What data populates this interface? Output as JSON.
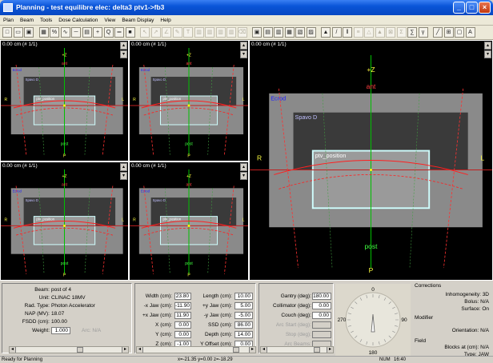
{
  "window": {
    "title": "Planning - test equilibre elec: delta3 ptv1->fb3"
  },
  "menu": [
    "Plan",
    "Beam",
    "Tools",
    "Dose Calculation",
    "View",
    "Beam Display",
    "Help"
  ],
  "toolbar_icons": [
    "new-icon",
    "open-icon",
    "save-icon",
    "grid-icon",
    "percent-icon",
    "isodose-icon",
    "ruler-icon",
    "table-icon",
    "crosshair-icon",
    "zoom-icon",
    "measure-icon",
    "color-icon",
    "pointer-icon",
    "arrow-icon",
    "contour-icon",
    "edit-icon",
    "text-icon",
    "layout-icon",
    "layout-icon",
    "layout-icon",
    "layout-icon",
    "eraser-icon",
    "view1-icon",
    "view2-icon",
    "view3-icon",
    "view4-icon",
    "view5-icon",
    "view6-icon",
    "warning-icon",
    "pencil-icon",
    "chart-icon",
    "align-icon",
    "triangle-icon",
    "warning-icon",
    "matrix-icon",
    "sum-icon",
    "sigma-icon",
    "gamma-icon",
    "dvh-icon",
    "view-icon",
    "window-icon",
    "font-icon"
  ],
  "views": [
    {
      "label": "0.00 cm (# 1/1)",
      "anterior": "ant",
      "posterior": "post",
      "top": "+Z",
      "bottom": "P",
      "left": "R",
      "right": "L",
      "structure_body": "Ecrod",
      "structure_spine": "Spavo D",
      "structure_ptv": "ptv_position"
    },
    {
      "label": "0.00 cm (# 1/1)",
      "anterior": "ant",
      "posterior": "post",
      "top": "+Z",
      "bottom": "P",
      "left": "R",
      "right": "L",
      "structure_body": "Ecrod",
      "structure_spine": "Spavo D",
      "structure_ptv": "ptv_position"
    },
    {
      "label": "0.00 cm (# 1/1)",
      "anterior": "ant",
      "posterior": "post",
      "top": "+Z",
      "bottom": "P",
      "left": "R",
      "right": "L",
      "structure_body": "Ecrod",
      "structure_spine": "Spavo D",
      "structure_ptv": "ptv_position"
    },
    {
      "label": "0.00 cm (# 1/1)",
      "anterior": "ant",
      "posterior": "post",
      "top": "+Z",
      "bottom": "P",
      "left": "R",
      "right": "L",
      "structure_body": "Ecrod",
      "structure_spine": "Spavo D",
      "structure_ptv": "ptv_position"
    },
    {
      "label": "0.00 cm (# 1/1)",
      "anterior": "ant",
      "posterior": "post",
      "top": "+Z",
      "bottom": "P",
      "left": "R",
      "right": "L",
      "structure_body": "Ecrod",
      "structure_spine": "Spavo D",
      "structure_ptv": "ptv_position"
    }
  ],
  "beam_info": {
    "beam_label": "Beam:",
    "beam_value": "post of 4",
    "unit_label": "Unit:",
    "unit_value": "CLINAC 18MV",
    "radtype_label": "Rad. Type:",
    "radtype_value": "Photon Accelerator",
    "nap_label": "NAP (MV):",
    "nap_value": "18.07",
    "fsdd_label": "FSDD (cm):",
    "fsdd_value": "100.00",
    "weight_label": "Weight:",
    "weight_value": "1.000",
    "arc_label": "Arc: N/A"
  },
  "geometry": {
    "width_label": "Width (cm):",
    "width_value": "23.80",
    "length_label": "Length (cm):",
    "length_value": "10.00",
    "xjaw_neg_label": "-x Jaw (cm):",
    "xjaw_neg_value": "-11.90",
    "yjaw_pos_label": "+y Jaw (cm):",
    "yjaw_pos_value": "5.00",
    "xjaw_pos_label": "+x Jaw (cm):",
    "xjaw_pos_value": "11.90",
    "yjaw_neg_label": "-y Jaw (cm):",
    "yjaw_neg_value": "-5.00",
    "x_label": "X (cm):",
    "x_value": "0.00",
    "ssd_label": "SSD (cm):",
    "ssd_value": "86.00",
    "y_label": "Y (cm):",
    "y_value": "0.00",
    "depth_label": "Depth (cm):",
    "depth_value": "14.00",
    "z_label": "Z (cm):",
    "z_value": "-1.00",
    "yoffset_label": "Y Offset (cm):",
    "yoffset_value": "0.00"
  },
  "angles": {
    "gantry_label": "Gantry (deg):",
    "gantry_value": "180.00",
    "collimator_label": "Collimator (deg):",
    "collimator_value": "0.00",
    "couch_label": "Couch (deg):",
    "couch_value": "0.00",
    "arcstart_label": "Arc Start (deg):",
    "stop_label": "Stop (deg):",
    "arcbeams_label": "Arc Beams:"
  },
  "dial": {
    "top": "0",
    "right": "90",
    "bottom": "180",
    "left": "270"
  },
  "corrections": {
    "title": "Corrections",
    "inhomogeneity": "Inhomogeneity: 3D",
    "bolus": "Bolus: N/A",
    "surface": "Surface: On",
    "modifier_title": "Modifier",
    "orientation": "Orientation: N/A",
    "field_title": "Field",
    "blocks": "Blocks at (cm): N/A",
    "type": "Type: JAW"
  },
  "status": {
    "left": "Ready for Planning",
    "middle": "x=-21.35 y=0.00 z=-18.29",
    "num": "NUM",
    "time": "16:40"
  },
  "colors": {
    "accent": "#0a55d8",
    "beam": "#ff2020",
    "axis_green": "#00c000",
    "ptv": "#c8ffff",
    "body": "#808080"
  }
}
